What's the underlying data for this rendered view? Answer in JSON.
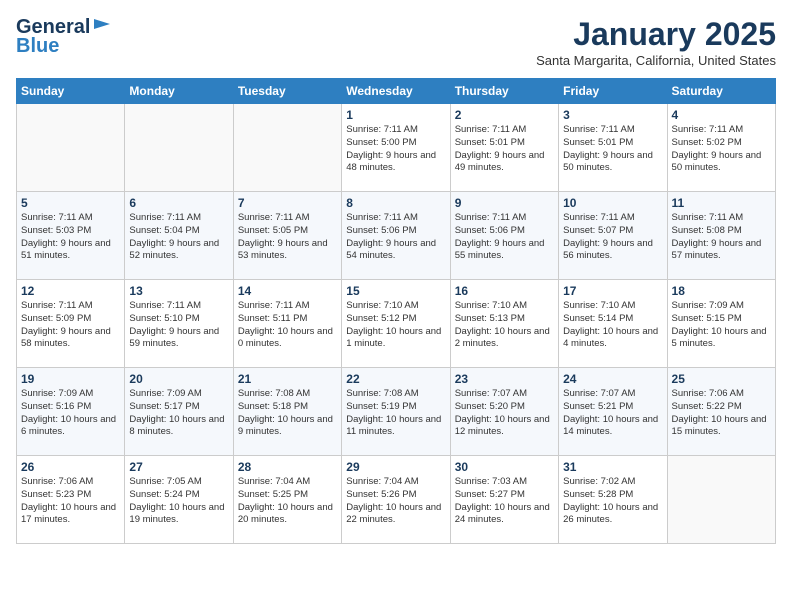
{
  "header": {
    "logo_line1": "General",
    "logo_line2": "Blue",
    "month": "January 2025",
    "location": "Santa Margarita, California, United States"
  },
  "weekdays": [
    "Sunday",
    "Monday",
    "Tuesday",
    "Wednesday",
    "Thursday",
    "Friday",
    "Saturday"
  ],
  "weeks": [
    [
      {
        "day": "",
        "info": ""
      },
      {
        "day": "",
        "info": ""
      },
      {
        "day": "",
        "info": ""
      },
      {
        "day": "1",
        "info": "Sunrise: 7:11 AM\nSunset: 5:00 PM\nDaylight: 9 hours and 48 minutes."
      },
      {
        "day": "2",
        "info": "Sunrise: 7:11 AM\nSunset: 5:01 PM\nDaylight: 9 hours and 49 minutes."
      },
      {
        "day": "3",
        "info": "Sunrise: 7:11 AM\nSunset: 5:01 PM\nDaylight: 9 hours and 50 minutes."
      },
      {
        "day": "4",
        "info": "Sunrise: 7:11 AM\nSunset: 5:02 PM\nDaylight: 9 hours and 50 minutes."
      }
    ],
    [
      {
        "day": "5",
        "info": "Sunrise: 7:11 AM\nSunset: 5:03 PM\nDaylight: 9 hours and 51 minutes."
      },
      {
        "day": "6",
        "info": "Sunrise: 7:11 AM\nSunset: 5:04 PM\nDaylight: 9 hours and 52 minutes."
      },
      {
        "day": "7",
        "info": "Sunrise: 7:11 AM\nSunset: 5:05 PM\nDaylight: 9 hours and 53 minutes."
      },
      {
        "day": "8",
        "info": "Sunrise: 7:11 AM\nSunset: 5:06 PM\nDaylight: 9 hours and 54 minutes."
      },
      {
        "day": "9",
        "info": "Sunrise: 7:11 AM\nSunset: 5:06 PM\nDaylight: 9 hours and 55 minutes."
      },
      {
        "day": "10",
        "info": "Sunrise: 7:11 AM\nSunset: 5:07 PM\nDaylight: 9 hours and 56 minutes."
      },
      {
        "day": "11",
        "info": "Sunrise: 7:11 AM\nSunset: 5:08 PM\nDaylight: 9 hours and 57 minutes."
      }
    ],
    [
      {
        "day": "12",
        "info": "Sunrise: 7:11 AM\nSunset: 5:09 PM\nDaylight: 9 hours and 58 minutes."
      },
      {
        "day": "13",
        "info": "Sunrise: 7:11 AM\nSunset: 5:10 PM\nDaylight: 9 hours and 59 minutes."
      },
      {
        "day": "14",
        "info": "Sunrise: 7:11 AM\nSunset: 5:11 PM\nDaylight: 10 hours and 0 minutes."
      },
      {
        "day": "15",
        "info": "Sunrise: 7:10 AM\nSunset: 5:12 PM\nDaylight: 10 hours and 1 minute."
      },
      {
        "day": "16",
        "info": "Sunrise: 7:10 AM\nSunset: 5:13 PM\nDaylight: 10 hours and 2 minutes."
      },
      {
        "day": "17",
        "info": "Sunrise: 7:10 AM\nSunset: 5:14 PM\nDaylight: 10 hours and 4 minutes."
      },
      {
        "day": "18",
        "info": "Sunrise: 7:09 AM\nSunset: 5:15 PM\nDaylight: 10 hours and 5 minutes."
      }
    ],
    [
      {
        "day": "19",
        "info": "Sunrise: 7:09 AM\nSunset: 5:16 PM\nDaylight: 10 hours and 6 minutes."
      },
      {
        "day": "20",
        "info": "Sunrise: 7:09 AM\nSunset: 5:17 PM\nDaylight: 10 hours and 8 minutes."
      },
      {
        "day": "21",
        "info": "Sunrise: 7:08 AM\nSunset: 5:18 PM\nDaylight: 10 hours and 9 minutes."
      },
      {
        "day": "22",
        "info": "Sunrise: 7:08 AM\nSunset: 5:19 PM\nDaylight: 10 hours and 11 minutes."
      },
      {
        "day": "23",
        "info": "Sunrise: 7:07 AM\nSunset: 5:20 PM\nDaylight: 10 hours and 12 minutes."
      },
      {
        "day": "24",
        "info": "Sunrise: 7:07 AM\nSunset: 5:21 PM\nDaylight: 10 hours and 14 minutes."
      },
      {
        "day": "25",
        "info": "Sunrise: 7:06 AM\nSunset: 5:22 PM\nDaylight: 10 hours and 15 minutes."
      }
    ],
    [
      {
        "day": "26",
        "info": "Sunrise: 7:06 AM\nSunset: 5:23 PM\nDaylight: 10 hours and 17 minutes."
      },
      {
        "day": "27",
        "info": "Sunrise: 7:05 AM\nSunset: 5:24 PM\nDaylight: 10 hours and 19 minutes."
      },
      {
        "day": "28",
        "info": "Sunrise: 7:04 AM\nSunset: 5:25 PM\nDaylight: 10 hours and 20 minutes."
      },
      {
        "day": "29",
        "info": "Sunrise: 7:04 AM\nSunset: 5:26 PM\nDaylight: 10 hours and 22 minutes."
      },
      {
        "day": "30",
        "info": "Sunrise: 7:03 AM\nSunset: 5:27 PM\nDaylight: 10 hours and 24 minutes."
      },
      {
        "day": "31",
        "info": "Sunrise: 7:02 AM\nSunset: 5:28 PM\nDaylight: 10 hours and 26 minutes."
      },
      {
        "day": "",
        "info": ""
      }
    ]
  ]
}
